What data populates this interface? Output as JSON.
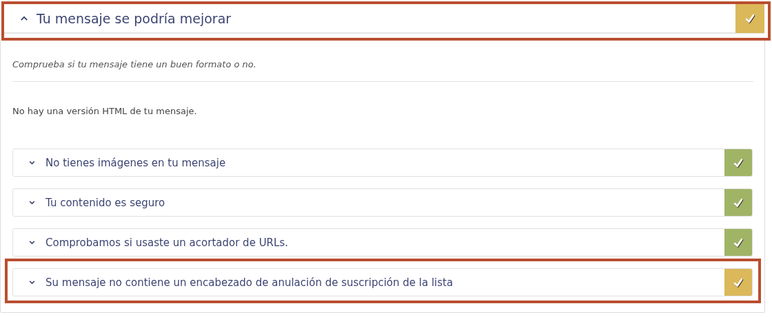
{
  "header": {
    "title": "Tu mensaje se podría mejorar",
    "expanded": true,
    "color": "#dbb85a",
    "highlighted": true
  },
  "description": "Comprueba si tu mensaje tiene un buen formato o no.",
  "note": "No hay una versión HTML de tu mensaje.",
  "checks": [
    {
      "title": "No tienes imágenes en tu mensaje",
      "expanded": false,
      "color": "#a0b466",
      "highlighted": false
    },
    {
      "title": "Tu contenido es seguro",
      "expanded": false,
      "color": "#a0b466",
      "highlighted": false
    },
    {
      "title": "Comprobamos si usaste un acortador de URLs.",
      "expanded": false,
      "color": "#a0b466",
      "highlighted": false
    },
    {
      "title": "Su mensaje no contiene un encabezado de anulación de suscripción de la lista",
      "expanded": false,
      "color": "#dbb85a",
      "highlighted": true
    }
  ]
}
